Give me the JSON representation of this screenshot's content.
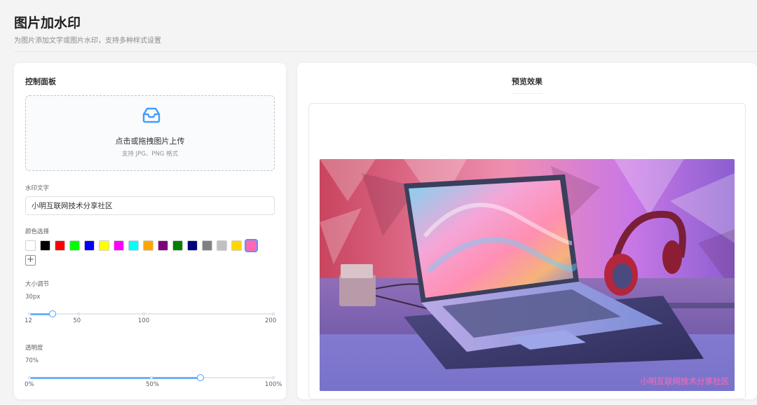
{
  "header": {
    "title": "图片加水印",
    "subtitle": "为图片添加文字或图片水印，支持多种样式设置"
  },
  "control_panel": {
    "title": "控制面板",
    "upload": {
      "icon": "inbox-icon",
      "text": "点击或拖拽图片上传",
      "tip": "支持 JPG、PNG 格式"
    },
    "watermark_text": {
      "label": "水印文字",
      "value": "小明互联网技术分享社区"
    },
    "color": {
      "label": "颜色选择",
      "options": [
        "#ffffff",
        "#000000",
        "#ff0000",
        "#00ff00",
        "#0000ff",
        "#ffff00",
        "#ff00ff",
        "#00ffff",
        "#ffa500",
        "#800080",
        "#008000",
        "#000080",
        "#808080",
        "#c0c0c0",
        "#ffd700",
        "#ff69b4"
      ],
      "selected": "#ff69b4",
      "add_symbol": "+"
    },
    "size": {
      "label": "大小调节",
      "value_text": "30px",
      "value": 30,
      "min": 12,
      "max": 200,
      "marks": [
        "12",
        "50",
        "100",
        "200"
      ]
    },
    "opacity": {
      "label": "透明度",
      "value_text": "70%",
      "value": 70,
      "min": 0,
      "max": 100,
      "marks": [
        "0%",
        "50%",
        "100%"
      ]
    }
  },
  "preview": {
    "title": "预览效果",
    "watermark_text": "小明互联网技术分享社区",
    "image_description": "laptop-with-headphones-photo"
  }
}
